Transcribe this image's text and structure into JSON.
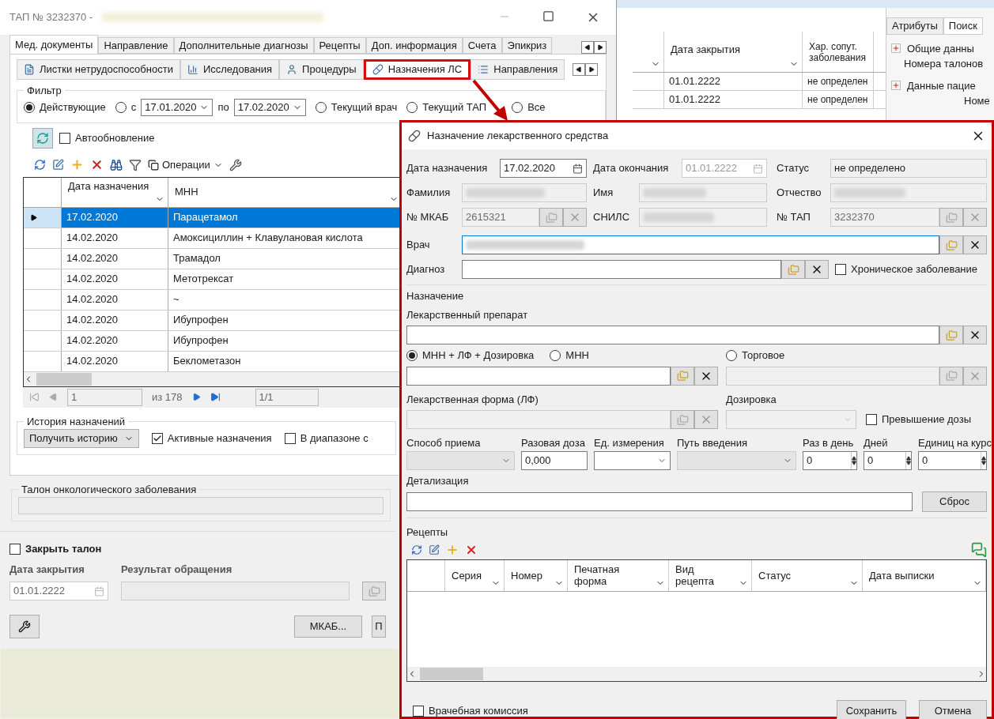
{
  "main_window": {
    "title": "ТАП № 3232370 -",
    "tabs": [
      {
        "label": "Мед. документы",
        "selected": true
      },
      {
        "label": "Направление",
        "selected": false
      },
      {
        "label": "Дополнительные диагнозы",
        "selected": false
      },
      {
        "label": "Рецепты",
        "selected": false
      },
      {
        "label": "Доп. информация",
        "selected": false
      },
      {
        "label": "Счета",
        "selected": false
      },
      {
        "label": "Эпикриз",
        "selected": false
      }
    ],
    "subtabs": [
      {
        "label": "Листки нетрудоспособности",
        "selected": false,
        "highlighted": false
      },
      {
        "label": "Исследования",
        "selected": false,
        "highlighted": false
      },
      {
        "label": "Процедуры",
        "selected": false,
        "highlighted": false
      },
      {
        "label": "Назначения ЛС",
        "selected": true,
        "highlighted": true
      },
      {
        "label": "Направления",
        "selected": false,
        "highlighted": false
      }
    ],
    "filter": {
      "title": "Фильтр",
      "options": [
        {
          "kind": "plain",
          "label": "Действующие",
          "selected": true
        },
        {
          "kind": "range",
          "label": "с",
          "selected": false,
          "from": "17.01.2020",
          "to_label": "по",
          "to": "17.02.2020"
        },
        {
          "kind": "plain",
          "label": "Текущий врач",
          "selected": false
        },
        {
          "kind": "plain",
          "label": "Текущий ТАП",
          "selected": false
        },
        {
          "kind": "plain",
          "label": "Все",
          "selected": false
        }
      ]
    },
    "autoupdate": {
      "label": "Автообновление",
      "checked": false
    },
    "operations": "Операции",
    "table": {
      "columns": [
        "Дата назначения",
        "МНН"
      ],
      "rows": [
        {
          "date": "17.02.2020",
          "name": "Парацетамол",
          "selected": true
        },
        {
          "date": "14.02.2020",
          "name": "Амоксициллин + Клавулановая кислота",
          "selected": false
        },
        {
          "date": "14.02.2020",
          "name": "Трамадол",
          "selected": false
        },
        {
          "date": "14.02.2020",
          "name": "Метотрексат",
          "selected": false
        },
        {
          "date": "14.02.2020",
          "name": "~",
          "selected": false
        },
        {
          "date": "14.02.2020",
          "name": "Ибупрофен",
          "selected": false
        },
        {
          "date": "14.02.2020",
          "name": "Ибупрофен",
          "selected": false
        },
        {
          "date": "14.02.2020",
          "name": "Беклометазон",
          "selected": false
        }
      ]
    },
    "pager": {
      "page": "1",
      "total": "из 178",
      "sub_page": "1/1"
    },
    "history": {
      "title": "История назначений",
      "button": "Получить историю",
      "active": {
        "label": "Активные назначения",
        "checked": true
      },
      "range": {
        "label": "В диапазоне с",
        "checked": false
      }
    },
    "onco": {
      "title": "Талон онкологического заболевания"
    },
    "close_ticket": {
      "label": "Закрыть талон",
      "checked": false
    },
    "close_date": {
      "label": "Дата закрытия",
      "value": "01.01.2222"
    },
    "result": {
      "label": "Результат обращения"
    },
    "buttons": [
      "МКАБ...",
      "П"
    ]
  },
  "background_window": {
    "tabs": [
      {
        "label": "Атрибуты",
        "selected": false
      },
      {
        "label": "Поиск",
        "selected": true
      }
    ],
    "groups": [
      {
        "title": "Общие данны",
        "line": "Номера талонов"
      },
      {
        "title": "Данные пацие",
        "line": "Номе"
      }
    ],
    "columns": [
      "Дата закрытия",
      "Хар. сопут. заболевания"
    ],
    "rows": [
      [
        "01.01.2222",
        "не определен"
      ],
      [
        "01.01.2222",
        "не определен"
      ]
    ]
  },
  "dialog": {
    "title": "Назначение лекарственного средства",
    "start_date": {
      "label": "Дата назначения",
      "value": "17.02.2020"
    },
    "end_date": {
      "label": "Дата окончания",
      "value": "01.01.2222"
    },
    "status": {
      "label": "Статус",
      "value": "не определено"
    },
    "surname": {
      "label": "Фамилия"
    },
    "name": {
      "label": "Имя"
    },
    "patronymic": {
      "label": "Отчество"
    },
    "mkab": {
      "label": "№ МКАБ",
      "value": "2615321"
    },
    "snils": {
      "label": "СНИЛС"
    },
    "tap": {
      "label": "№ ТАП",
      "value": "3232370"
    },
    "doctor": {
      "label": "Врач"
    },
    "diagnosis": {
      "label": "Диагноз"
    },
    "chronic": {
      "label": "Хроническое заболевание",
      "checked": false
    },
    "section": "Назначение",
    "drug_label": "Лекарственный препарат",
    "mode_options": [
      {
        "label": "МНН + ЛФ + Дозировка",
        "selected": true
      },
      {
        "label": "МНН",
        "selected": false
      },
      {
        "label": "Торговое",
        "selected": false
      }
    ],
    "form_label": "Лекарственная форма (ЛФ)",
    "dosage_label": "Дозировка",
    "overdose": {
      "label": "Превышение дозы",
      "checked": false
    },
    "intake": [
      {
        "label": "Способ приема",
        "kind": "select",
        "disabled": true
      },
      {
        "label": "Разовая доза",
        "kind": "text",
        "value": "0,000",
        "disabled": false
      },
      {
        "label": "Ед. измерения",
        "kind": "select",
        "disabled": false
      },
      {
        "label": "Путь введения",
        "kind": "select",
        "disabled": true
      },
      {
        "label": "Раз в день",
        "kind": "spin",
        "value": "0",
        "disabled": false
      },
      {
        "label": "Дней",
        "kind": "spin",
        "value": "0",
        "disabled": false
      },
      {
        "label": "Единиц на курс",
        "kind": "spin",
        "value": "0",
        "disabled": false
      }
    ],
    "detail_label": "Детализация",
    "reset": "Сброс",
    "recipes": {
      "title": "Рецепты",
      "columns": [
        "Серия",
        "Номер",
        "Печатная форма",
        "Вид рецепта",
        "Статус",
        "Дата выписки"
      ]
    },
    "commission": {
      "label": "Врачебная комиссия",
      "checked": false
    },
    "buttons": [
      "Сохранить",
      "Отмена"
    ]
  }
}
